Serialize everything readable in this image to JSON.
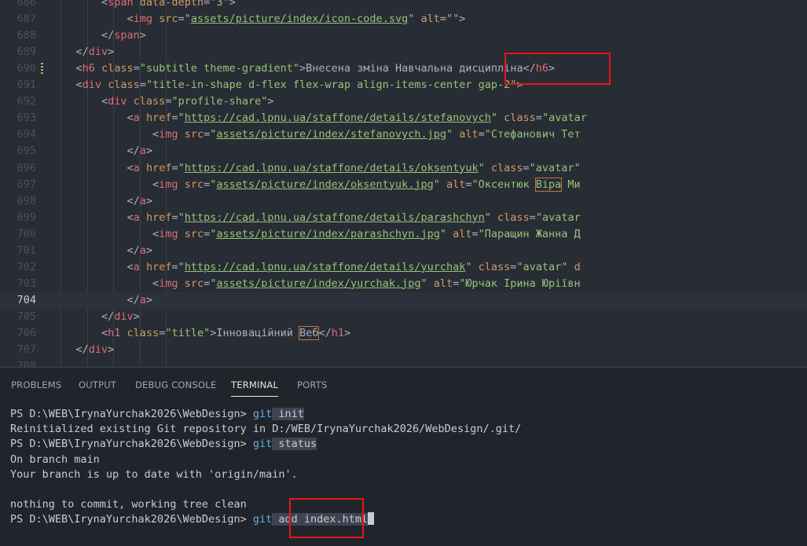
{
  "editor": {
    "current_line": "704",
    "lines": [
      {
        "num": "686",
        "segments": [
          {
            "c": "t-punc",
            "t": "        <"
          },
          {
            "c": "t-tag",
            "t": "span"
          },
          {
            "c": "t-attr",
            "t": " data-depth"
          },
          {
            "c": "t-punc",
            "t": "="
          },
          {
            "c": "t-str",
            "t": "\"3\""
          },
          {
            "c": "t-punc",
            "t": ">"
          }
        ]
      },
      {
        "num": "687",
        "segments": [
          {
            "c": "t-punc",
            "t": "            <"
          },
          {
            "c": "t-tag",
            "t": "img"
          },
          {
            "c": "t-attr",
            "t": " src"
          },
          {
            "c": "t-punc",
            "t": "="
          },
          {
            "c": "t-str",
            "t": "\""
          },
          {
            "c": "t-url",
            "t": "assets/picture/index/icon-code.svg"
          },
          {
            "c": "t-str",
            "t": "\""
          },
          {
            "c": "t-attr",
            "t": " alt"
          },
          {
            "c": "t-punc",
            "t": "="
          },
          {
            "c": "t-str",
            "t": "\"\""
          },
          {
            "c": "t-punc",
            "t": ">"
          }
        ]
      },
      {
        "num": "688",
        "segments": [
          {
            "c": "t-punc",
            "t": "        </"
          },
          {
            "c": "t-tag",
            "t": "span"
          },
          {
            "c": "t-punc",
            "t": ">"
          }
        ]
      },
      {
        "num": "689",
        "segments": [
          {
            "c": "t-punc",
            "t": "    </"
          },
          {
            "c": "t-tag",
            "t": "div"
          },
          {
            "c": "t-punc",
            "t": ">"
          }
        ]
      },
      {
        "num": "690",
        "segments": [
          {
            "c": "t-punc",
            "t": "    <"
          },
          {
            "c": "t-tag",
            "t": "h6"
          },
          {
            "c": "t-attr",
            "t": " class"
          },
          {
            "c": "t-punc",
            "t": "="
          },
          {
            "c": "t-str",
            "t": "\"subtitle theme-gradient\""
          },
          {
            "c": "t-punc",
            "t": ">"
          },
          {
            "c": "t-text",
            "t": "Внесена зміна Навчальна дисципліна"
          },
          {
            "c": "t-punc",
            "t": "</"
          },
          {
            "c": "t-tag",
            "t": "h6"
          },
          {
            "c": "t-punc",
            "t": ">"
          }
        ]
      },
      {
        "num": "691",
        "segments": [
          {
            "c": "t-punc",
            "t": "    <"
          },
          {
            "c": "t-tag",
            "t": "div"
          },
          {
            "c": "t-attr",
            "t": " class"
          },
          {
            "c": "t-punc",
            "t": "="
          },
          {
            "c": "t-str",
            "t": "\"title-in-shape d-flex flex-wrap align-items-center gap-2\""
          },
          {
            "c": "t-punc",
            "t": ">"
          }
        ]
      },
      {
        "num": "692",
        "segments": [
          {
            "c": "t-punc",
            "t": "        <"
          },
          {
            "c": "t-tag",
            "t": "div"
          },
          {
            "c": "t-attr",
            "t": " class"
          },
          {
            "c": "t-punc",
            "t": "="
          },
          {
            "c": "t-str",
            "t": "\"profile-share\""
          },
          {
            "c": "t-punc",
            "t": ">"
          }
        ]
      },
      {
        "num": "693",
        "segments": [
          {
            "c": "t-punc",
            "t": "            <"
          },
          {
            "c": "t-tag",
            "t": "a"
          },
          {
            "c": "t-attr",
            "t": " href"
          },
          {
            "c": "t-punc",
            "t": "="
          },
          {
            "c": "t-str",
            "t": "\""
          },
          {
            "c": "t-url",
            "t": "https://cad.lpnu.ua/staffone/details/stefanovych"
          },
          {
            "c": "t-str",
            "t": "\""
          },
          {
            "c": "t-attr",
            "t": " class"
          },
          {
            "c": "t-punc",
            "t": "="
          },
          {
            "c": "t-str",
            "t": "\"avatar"
          }
        ]
      },
      {
        "num": "694",
        "segments": [
          {
            "c": "t-punc",
            "t": "                <"
          },
          {
            "c": "t-tag",
            "t": "img"
          },
          {
            "c": "t-attr",
            "t": " src"
          },
          {
            "c": "t-punc",
            "t": "="
          },
          {
            "c": "t-str",
            "t": "\""
          },
          {
            "c": "t-url",
            "t": "assets/picture/index/stefanovych.jpg"
          },
          {
            "c": "t-str",
            "t": "\""
          },
          {
            "c": "t-attr",
            "t": " alt"
          },
          {
            "c": "t-punc",
            "t": "="
          },
          {
            "c": "t-str",
            "t": "\"Стефанович Тет"
          }
        ]
      },
      {
        "num": "695",
        "segments": [
          {
            "c": "t-punc",
            "t": "            </"
          },
          {
            "c": "t-tag",
            "t": "a"
          },
          {
            "c": "t-punc",
            "t": ">"
          }
        ]
      },
      {
        "num": "696",
        "segments": [
          {
            "c": "t-punc",
            "t": "            <"
          },
          {
            "c": "t-tag",
            "t": "a"
          },
          {
            "c": "t-attr",
            "t": " href"
          },
          {
            "c": "t-punc",
            "t": "="
          },
          {
            "c": "t-str",
            "t": "\""
          },
          {
            "c": "t-url",
            "t": "https://cad.lpnu.ua/staffone/details/oksentyuk"
          },
          {
            "c": "t-str",
            "t": "\""
          },
          {
            "c": "t-attr",
            "t": " class"
          },
          {
            "c": "t-punc",
            "t": "="
          },
          {
            "c": "t-str",
            "t": "\"avatar\""
          }
        ]
      },
      {
        "num": "697",
        "segments": [
          {
            "c": "t-punc",
            "t": "                <"
          },
          {
            "c": "t-tag",
            "t": "img"
          },
          {
            "c": "t-attr",
            "t": " src"
          },
          {
            "c": "t-punc",
            "t": "="
          },
          {
            "c": "t-str",
            "t": "\""
          },
          {
            "c": "t-url",
            "t": "assets/picture/index/oksentyuk.jpg"
          },
          {
            "c": "t-str",
            "t": "\""
          },
          {
            "c": "t-attr",
            "t": " alt"
          },
          {
            "c": "t-punc",
            "t": "="
          },
          {
            "c": "t-str",
            "t": "\"Оксентюк "
          },
          {
            "c": "t-str t-box",
            "t": "Віра"
          },
          {
            "c": "t-str",
            "t": " Ми"
          }
        ]
      },
      {
        "num": "698",
        "segments": [
          {
            "c": "t-punc",
            "t": "            </"
          },
          {
            "c": "t-tag",
            "t": "a"
          },
          {
            "c": "t-punc",
            "t": ">"
          }
        ]
      },
      {
        "num": "699",
        "segments": [
          {
            "c": "t-punc",
            "t": "            <"
          },
          {
            "c": "t-tag",
            "t": "a"
          },
          {
            "c": "t-attr",
            "t": " href"
          },
          {
            "c": "t-punc",
            "t": "="
          },
          {
            "c": "t-str",
            "t": "\""
          },
          {
            "c": "t-url",
            "t": "https://cad.lpnu.ua/staffone/details/parashchyn"
          },
          {
            "c": "t-str",
            "t": "\""
          },
          {
            "c": "t-attr",
            "t": " class"
          },
          {
            "c": "t-punc",
            "t": "="
          },
          {
            "c": "t-str",
            "t": "\"avatar"
          }
        ]
      },
      {
        "num": "700",
        "segments": [
          {
            "c": "t-punc",
            "t": "                <"
          },
          {
            "c": "t-tag",
            "t": "img"
          },
          {
            "c": "t-attr",
            "t": " src"
          },
          {
            "c": "t-punc",
            "t": "="
          },
          {
            "c": "t-str",
            "t": "\""
          },
          {
            "c": "t-url",
            "t": "assets/picture/index/parashchyn.jpg"
          },
          {
            "c": "t-str",
            "t": "\""
          },
          {
            "c": "t-attr",
            "t": " alt"
          },
          {
            "c": "t-punc",
            "t": "="
          },
          {
            "c": "t-str",
            "t": "\"Паращин Жанна Д"
          }
        ]
      },
      {
        "num": "701",
        "segments": [
          {
            "c": "t-punc",
            "t": "            </"
          },
          {
            "c": "t-tag",
            "t": "a"
          },
          {
            "c": "t-punc",
            "t": ">"
          }
        ]
      },
      {
        "num": "702",
        "segments": [
          {
            "c": "t-punc",
            "t": "            <"
          },
          {
            "c": "t-tag",
            "t": "a"
          },
          {
            "c": "t-attr",
            "t": " href"
          },
          {
            "c": "t-punc",
            "t": "="
          },
          {
            "c": "t-str",
            "t": "\""
          },
          {
            "c": "t-url",
            "t": "https://cad.lpnu.ua/staffone/details/yurchak"
          },
          {
            "c": "t-str",
            "t": "\""
          },
          {
            "c": "t-attr",
            "t": " class"
          },
          {
            "c": "t-punc",
            "t": "="
          },
          {
            "c": "t-str",
            "t": "\"avatar\""
          },
          {
            "c": "t-attr",
            "t": " d"
          }
        ]
      },
      {
        "num": "703",
        "segments": [
          {
            "c": "t-punc",
            "t": "                <"
          },
          {
            "c": "t-tag",
            "t": "img"
          },
          {
            "c": "t-attr",
            "t": " src"
          },
          {
            "c": "t-punc",
            "t": "="
          },
          {
            "c": "t-str",
            "t": "\""
          },
          {
            "c": "t-url",
            "t": "assets/picture/index/yurchak.jpg"
          },
          {
            "c": "t-str",
            "t": "\""
          },
          {
            "c": "t-attr",
            "t": " alt"
          },
          {
            "c": "t-punc",
            "t": "="
          },
          {
            "c": "t-str",
            "t": "\"Юрчак Ірина Юріївн"
          }
        ]
      },
      {
        "num": "704",
        "segments": [
          {
            "c": "t-punc",
            "t": "            </"
          },
          {
            "c": "t-tag",
            "t": "a"
          },
          {
            "c": "t-punc",
            "t": ">"
          }
        ]
      },
      {
        "num": "705",
        "segments": [
          {
            "c": "t-punc",
            "t": "        </"
          },
          {
            "c": "t-tag",
            "t": "div"
          },
          {
            "c": "t-punc",
            "t": ">"
          }
        ]
      },
      {
        "num": "706",
        "segments": [
          {
            "c": "t-punc",
            "t": "        <"
          },
          {
            "c": "t-tag",
            "t": "h1"
          },
          {
            "c": "t-attr",
            "t": " class"
          },
          {
            "c": "t-punc",
            "t": "="
          },
          {
            "c": "t-str",
            "t": "\"title\""
          },
          {
            "c": "t-punc",
            "t": ">"
          },
          {
            "c": "t-text",
            "t": "Інноваційний "
          },
          {
            "c": "t-text t-box",
            "t": "Веб"
          },
          {
            "c": "t-punc",
            "t": "</"
          },
          {
            "c": "t-tag",
            "t": "h1"
          },
          {
            "c": "t-punc",
            "t": ">"
          }
        ]
      },
      {
        "num": "707",
        "segments": [
          {
            "c": "t-punc",
            "t": "    </"
          },
          {
            "c": "t-tag",
            "t": "div"
          },
          {
            "c": "t-punc",
            "t": ">"
          }
        ]
      },
      {
        "num": "708",
        "segments": []
      }
    ]
  },
  "panel": {
    "tabs": [
      {
        "label": "PROBLEMS",
        "name": "tab-problems",
        "active": false
      },
      {
        "label": "OUTPUT",
        "name": "tab-output",
        "active": false
      },
      {
        "label": "DEBUG CONSOLE",
        "name": "tab-debug-console",
        "active": false
      },
      {
        "label": "TERMINAL",
        "name": "tab-terminal",
        "active": true
      },
      {
        "label": "PORTS",
        "name": "tab-ports",
        "active": false
      }
    ]
  },
  "terminal": {
    "prompt": "PS D:\\WEB\\IrynaYurchak2026\\WebDesign> ",
    "lines": [
      {
        "type": "cmd",
        "cmd": "git",
        "args": " init"
      },
      {
        "type": "out",
        "text": "Reinitialized existing Git repository in D:/WEB/IrynaYurchak2026/WebDesign/.git/"
      },
      {
        "type": "cmd",
        "cmd": "git",
        "args": " status"
      },
      {
        "type": "out",
        "text": "On branch main"
      },
      {
        "type": "out",
        "text": "Your branch is up to date with 'origin/main'."
      },
      {
        "type": "out",
        "text": ""
      },
      {
        "type": "out",
        "text": "nothing to commit, working tree clean"
      },
      {
        "type": "cmd",
        "cmd": "git",
        "args": " add index.html",
        "cursor": true
      }
    ]
  },
  "colors": {
    "highlight_box": "#e8141a",
    "editor_bg": "#282c34",
    "panel_bg": "#21252b"
  }
}
